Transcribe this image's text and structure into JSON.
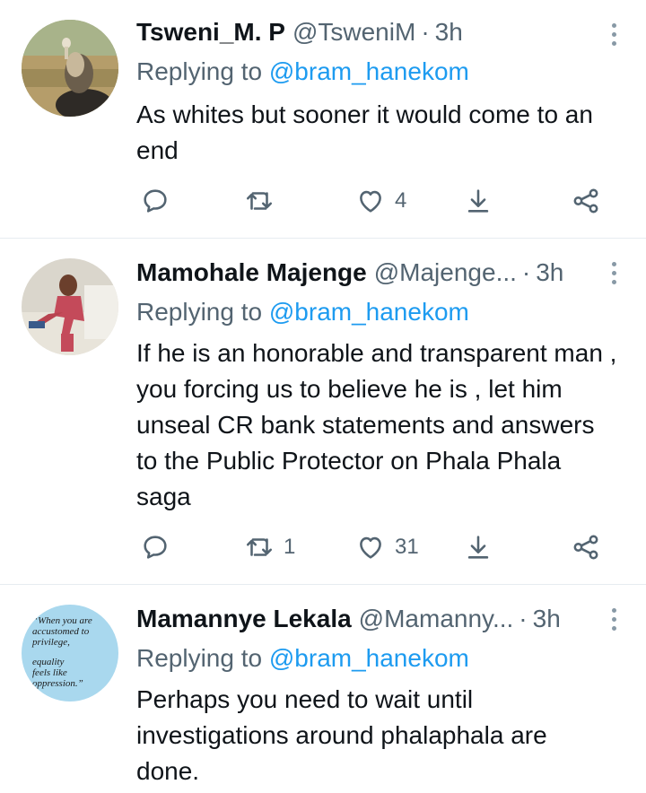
{
  "tweets": [
    {
      "name": "Tsweni_M. P",
      "handle": "@TsweniM",
      "separator": "·",
      "time": "3h",
      "replying_prefix": "Replying to",
      "replying_to": "@bram_hanekom",
      "text": "As whites but sooner it would come to an end",
      "actions": {
        "reply": "",
        "retweet": "",
        "like": "4"
      },
      "avatar_icon": "vulture-photo"
    },
    {
      "name": "Mamohale Majenge",
      "handle": "@Majenge...",
      "separator": "·",
      "time": "3h",
      "replying_prefix": "Replying to",
      "replying_to": "@bram_hanekom",
      "text": "If he is an honorable and transparent man , you forcing us to believe he is , let him unseal CR bank statements and answers to the Public Protector on Phala Phala saga",
      "actions": {
        "reply": "",
        "retweet": "1",
        "like": "31"
      },
      "avatar_icon": "person-on-couch-photo"
    },
    {
      "name": "Mamannye Lekala",
      "handle": "@Mamanny...",
      "separator": "·",
      "time": "3h",
      "replying_prefix": "Replying to",
      "replying_to": "@bram_hanekom",
      "text": "Perhaps you need to wait until investigations around phalaphala are done.",
      "actions": {
        "reply": "",
        "retweet": "",
        "like": ""
      },
      "avatar_quote": {
        "line1": "“When you are",
        "line2": "accustomed to",
        "line3": "privilege,",
        "line4": "equality",
        "line5": "feels like",
        "line6": "oppression.”"
      }
    }
  ],
  "colors": {
    "text": "#0f1419",
    "secondary": "#536471",
    "link": "#1d9bf0",
    "divider": "#e6ecf0",
    "avatar_quote_bg": "#a9d8ee"
  }
}
